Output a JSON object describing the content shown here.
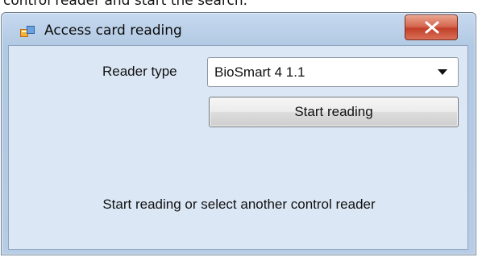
{
  "page_fragment": "control reader and start the search.",
  "window": {
    "title": "Access card reading",
    "app_icon": "form-window-icon",
    "close_icon": "close-x-icon"
  },
  "form": {
    "reader_type_label": "Reader type",
    "reader_type_value": "BioSmart 4 1.1",
    "dropdown_icon": "chevron-down-icon",
    "start_button_label": "Start reading",
    "status_text": "Start reading or select another control reader"
  },
  "colors": {
    "close_button": "#c8452f",
    "client_background": "#dbe7f5",
    "frame": "#b7cce5"
  }
}
